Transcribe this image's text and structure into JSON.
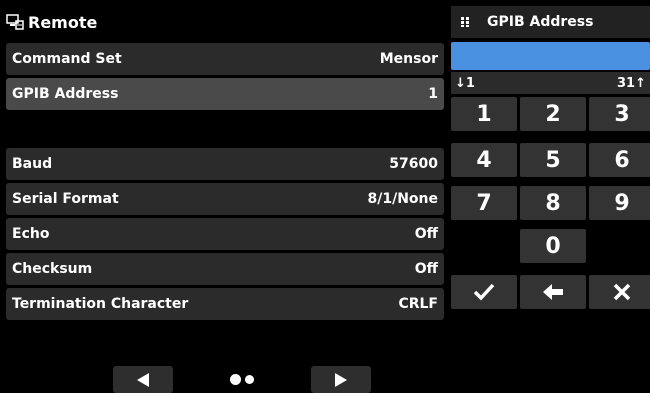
{
  "header": {
    "title": "Remote"
  },
  "settings": [
    {
      "label": "Command Set",
      "value": "Mensor"
    },
    {
      "label": "GPIB Address",
      "value": "1"
    },
    {
      "label": "",
      "value": ""
    },
    {
      "label": "Baud",
      "value": "57600"
    },
    {
      "label": "Serial Format",
      "value": "8/1/None"
    },
    {
      "label": "Echo",
      "value": "Off"
    },
    {
      "label": "Checksum",
      "value": "Off"
    },
    {
      "label": "Termination Character",
      "value": "CRLF"
    }
  ],
  "keypad": {
    "title": "GPIB Address",
    "input_value": "",
    "min_label": "↓1",
    "max_label": "31↑",
    "keys": [
      "1",
      "2",
      "3",
      "4",
      "5",
      "6",
      "7",
      "8",
      "9",
      "0"
    ],
    "confirm_icon": "check-icon",
    "back_icon": "backspace-arrow-icon",
    "cancel_icon": "close-icon"
  },
  "colors": {
    "input_accent": "#4a90e0",
    "selected_row": "#4a4a4a",
    "row": "#2b2b2b"
  },
  "pager": {
    "page": 1,
    "pages": 2
  }
}
